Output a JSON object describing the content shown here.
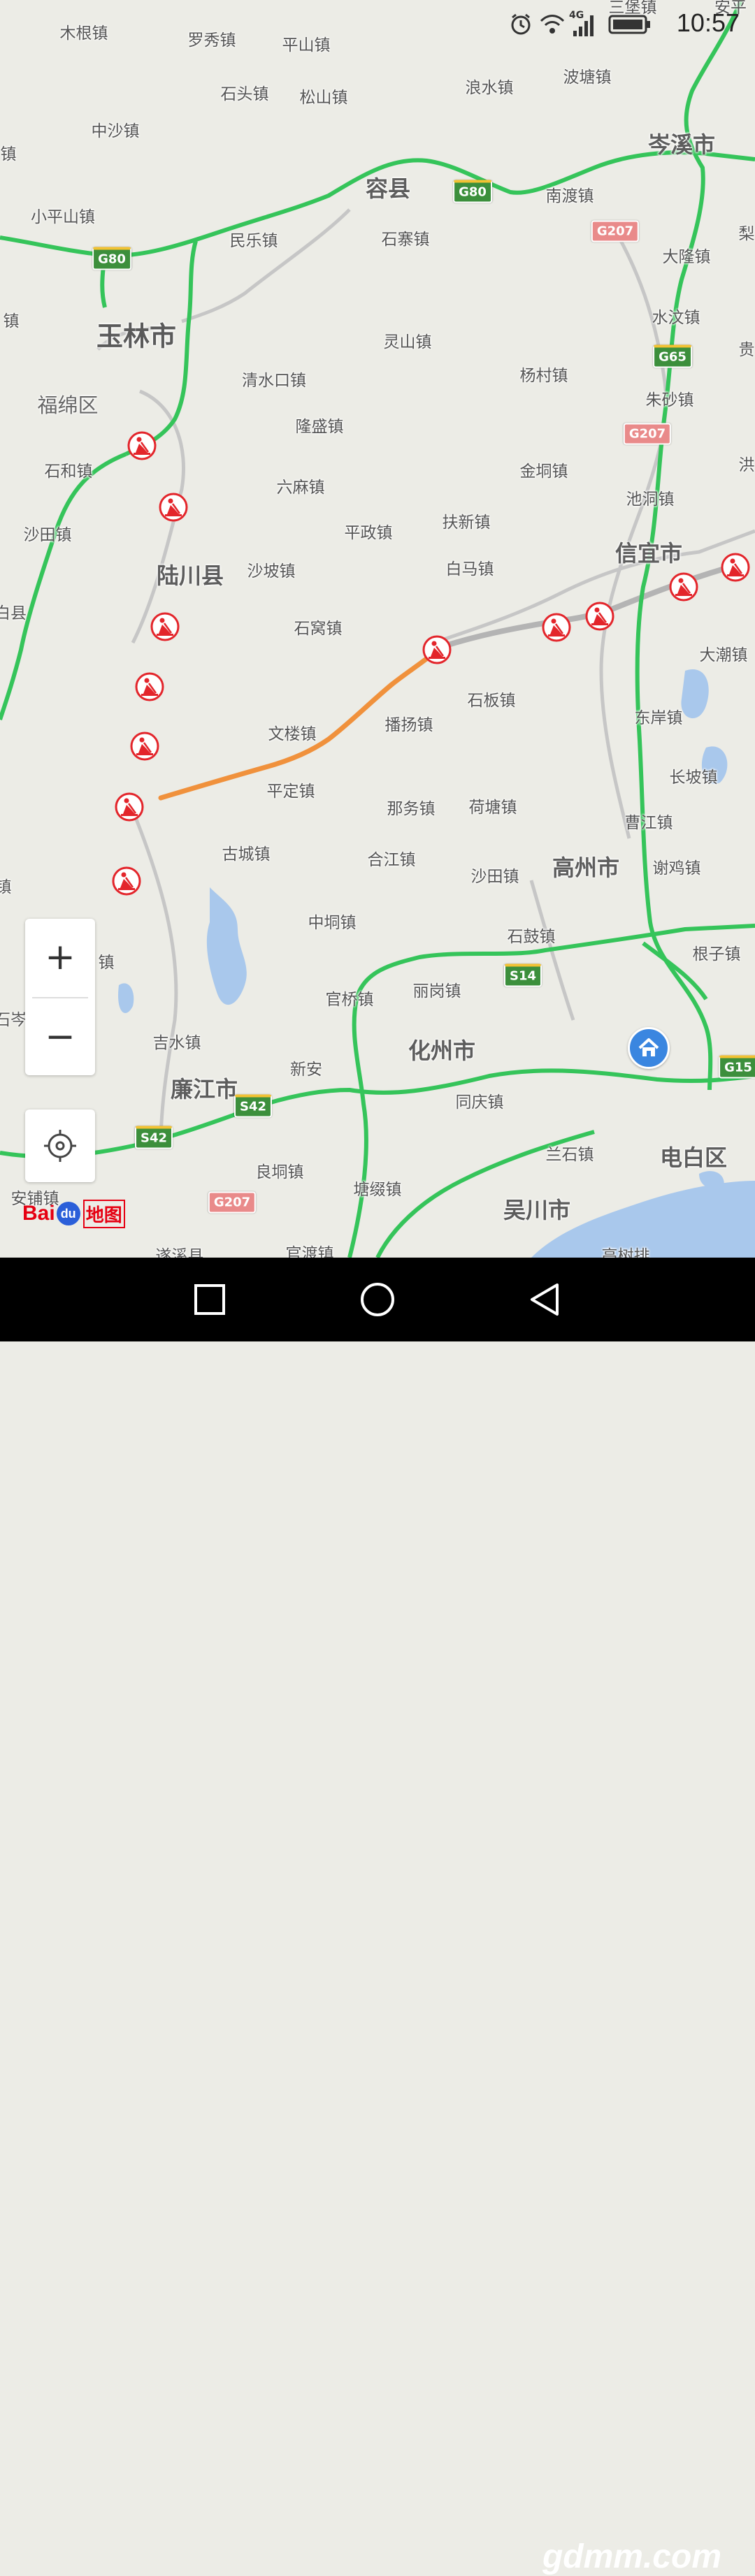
{
  "status_bar": {
    "time": "10:57",
    "network": "4G",
    "icons": [
      "alarm-icon",
      "wifi-icon",
      "signal-icon",
      "battery-icon"
    ]
  },
  "map": {
    "cities": [
      {
        "name": "玉林市",
        "size": "big"
      },
      {
        "name": "容县",
        "size": "city"
      },
      {
        "name": "岑溪市",
        "size": "city"
      },
      {
        "name": "陆川县",
        "size": "city"
      },
      {
        "name": "信宜市",
        "size": "city"
      },
      {
        "name": "福绵区",
        "size": "county"
      },
      {
        "name": "高州市",
        "size": "city"
      },
      {
        "name": "化州市",
        "size": "city"
      },
      {
        "name": "廉江市",
        "size": "city"
      },
      {
        "name": "吴川市",
        "size": "city"
      },
      {
        "name": "电白区",
        "size": "city"
      }
    ],
    "towns": [
      "木根镇",
      "罗秀镇",
      "平山镇",
      "石头镇",
      "松山镇",
      "浪水镇",
      "波塘镇",
      "三堡镇",
      "中沙镇",
      "小平山镇",
      "民乐镇",
      "石寨镇",
      "南渡镇",
      "大隆镇",
      "灵山镇",
      "水汶镇",
      "清水口镇",
      "杨村镇",
      "朱砂镇",
      "隆盛镇",
      "石和镇",
      "六麻镇",
      "金垌镇",
      "池洞镇",
      "沙田镇",
      "平政镇",
      "扶新镇",
      "沙坡镇",
      "白马镇",
      "石窝镇",
      "大潮镇",
      "石板镇",
      "东岸镇",
      "文楼镇",
      "播扬镇",
      "长坡镇",
      "平定镇",
      "那务镇",
      "荷塘镇",
      "曹江镇",
      "古城镇",
      "合江镇",
      "谢鸡镇",
      "沙田镇",
      "中垌镇",
      "石鼓镇",
      "根子镇",
      "官桥镇",
      "丽岗镇",
      "吉水镇",
      "新安",
      "同庆镇",
      "兰石镇",
      "良垌镇",
      "塘缀镇",
      "安铺镇",
      "遂溪县",
      "官渡镇",
      "高树排",
      "镇",
      "镇",
      "镇",
      "梨",
      "贵",
      "洪",
      "安平",
      "白县",
      "镇",
      "石岑"
    ],
    "road_shields": [
      {
        "label": "G80",
        "color": "green"
      },
      {
        "label": "G80",
        "color": "green"
      },
      {
        "label": "G207",
        "color": "red"
      },
      {
        "label": "G65",
        "color": "green"
      },
      {
        "label": "G207",
        "color": "red"
      },
      {
        "label": "S14",
        "color": "green"
      },
      {
        "label": "G15",
        "color": "green"
      },
      {
        "label": "S42",
        "color": "green"
      },
      {
        "label": "S42",
        "color": "green"
      },
      {
        "label": "G207",
        "color": "red"
      }
    ],
    "construction_markers": 12,
    "colors": {
      "land": "#ecece6",
      "highway": "#35c45a",
      "route": "#f0913c",
      "grey_road": "#b9b9b9",
      "water": "#a9c8ec",
      "marker": "#e3252b"
    }
  },
  "controls": {
    "zoom_in": "+",
    "zoom_out": "−",
    "locate_icon": "locate-icon",
    "home_icon": "home-icon"
  },
  "logo": {
    "bai": "Bai",
    "du": "du",
    "ditu": "地图"
  },
  "nav_bar": {
    "icons": [
      "recent-apps-icon",
      "home-circle-icon",
      "back-icon"
    ]
  },
  "watermark": "gdmm.com"
}
